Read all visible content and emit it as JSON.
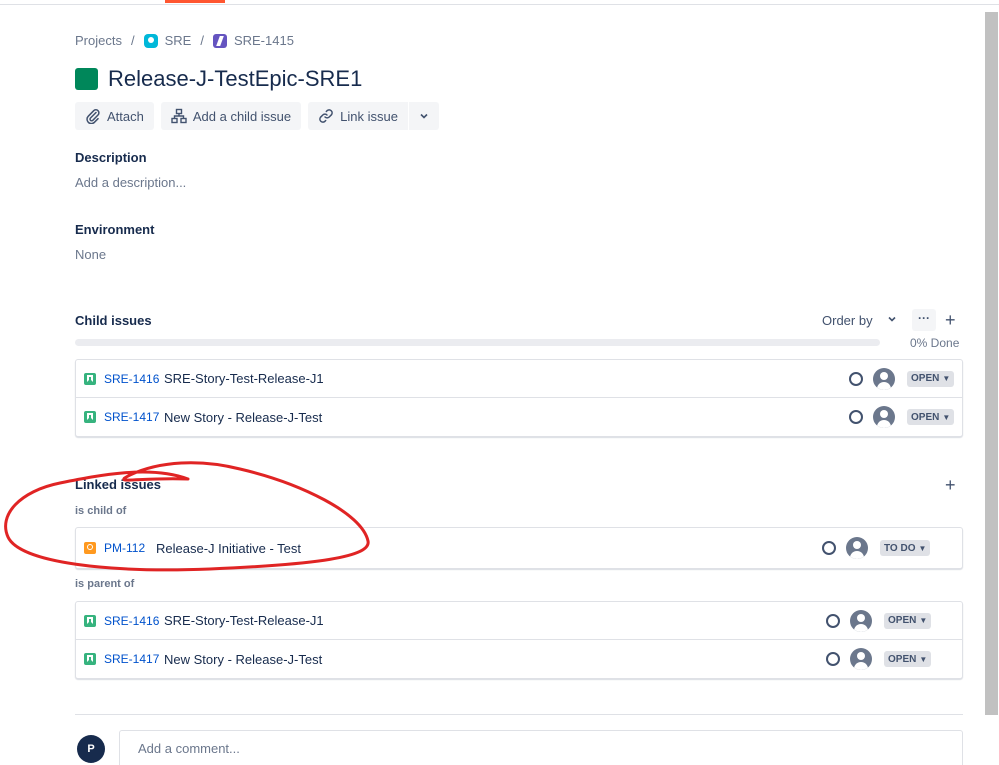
{
  "breadcrumb": {
    "projects": "Projects",
    "project": "SRE",
    "issue": "SRE-1415",
    "separator": "/"
  },
  "issue": {
    "title": "Release-J-TestEpic-SRE1",
    "epic_color": "#00875A"
  },
  "toolbar": {
    "attach_label": "Attach",
    "add_child_label": "Add a child issue",
    "link_issue_label": "Link issue",
    "more_icon": "chevron-down-icon"
  },
  "description": {
    "label": "Description",
    "placeholder": "Add a description..."
  },
  "environment": {
    "label": "Environment",
    "value": "None"
  },
  "child_issues": {
    "label": "Child issues",
    "order_by_label": "Order by",
    "more_label": "···",
    "add_label": "+",
    "progress_text": "0% Done",
    "progress_fraction": 0,
    "items": [
      {
        "key": "SRE-1416",
        "summary": "SRE-Story-Test-Release-J1",
        "status": "OPEN",
        "type": "story"
      },
      {
        "key": "SRE-1417",
        "summary": "New Story - Release-J-Test",
        "status": "OPEN",
        "type": "story"
      }
    ]
  },
  "linked_issues": {
    "label": "Linked issues",
    "add_label": "+",
    "groups": [
      {
        "relation": "is child of",
        "items": [
          {
            "key": "PM-112",
            "summary": "Release-J Initiative - Test",
            "status": "TO DO",
            "type": "initiative"
          }
        ]
      },
      {
        "relation": "is parent of",
        "items": [
          {
            "key": "SRE-1416",
            "summary": "SRE-Story-Test-Release-J1",
            "status": "OPEN",
            "type": "story"
          },
          {
            "key": "SRE-1417",
            "summary": "New Story - Release-J-Test",
            "status": "OPEN",
            "type": "story"
          }
        ]
      }
    ]
  },
  "comment": {
    "avatar_initial": "P",
    "placeholder": "Add a comment..."
  },
  "colors": {
    "link": "#0052CC",
    "story": "#36B37E",
    "initiative": "#FF991F",
    "annotation": "#E02424"
  }
}
